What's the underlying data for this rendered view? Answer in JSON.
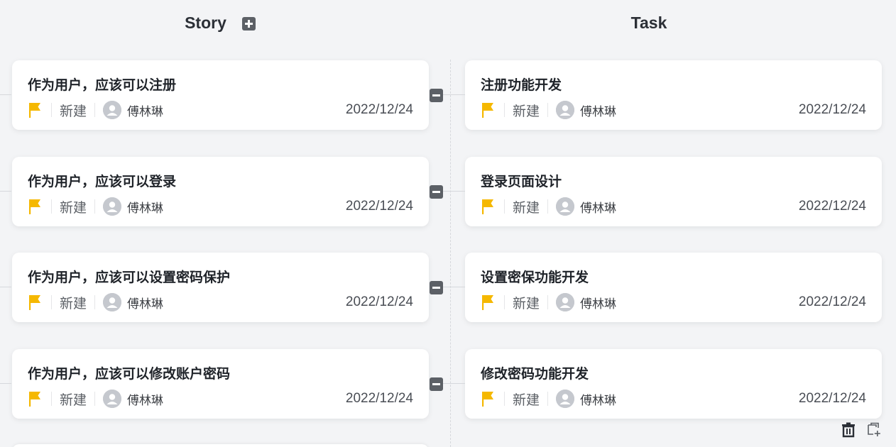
{
  "columns": {
    "story": {
      "title": "Story"
    },
    "task": {
      "title": "Task"
    }
  },
  "rows": [
    {
      "story": {
        "title": "作为用户，应该可以注册",
        "status": "新建",
        "assignee": "傅林琳",
        "date": "2022/12/24"
      },
      "task": {
        "title": "注册功能开发",
        "status": "新建",
        "assignee": "傅林琳",
        "date": "2022/12/24"
      }
    },
    {
      "story": {
        "title": "作为用户，应该可以登录",
        "status": "新建",
        "assignee": "傅林琳",
        "date": "2022/12/24"
      },
      "task": {
        "title": "登录页面设计",
        "status": "新建",
        "assignee": "傅林琳",
        "date": "2022/12/24"
      }
    },
    {
      "story": {
        "title": "作为用户，应该可以设置密码保护",
        "status": "新建",
        "assignee": "傅林琳",
        "date": "2022/12/24"
      },
      "task": {
        "title": "设置密保功能开发",
        "status": "新建",
        "assignee": "傅林琳",
        "date": "2022/12/24"
      }
    },
    {
      "story": {
        "title": "作为用户，应该可以修改账户密码",
        "status": "新建",
        "assignee": "傅林琳",
        "date": "2022/12/24"
      },
      "task": {
        "title": "修改密码功能开发",
        "status": "新建",
        "assignee": "傅林琳",
        "date": "2022/12/24"
      }
    }
  ],
  "icons": {
    "flag": "flag-icon",
    "avatar": "user-avatar-icon",
    "add": "plus-icon",
    "collapse": "minus-icon",
    "delete": "trash-icon",
    "add_link": "add-card-icon"
  },
  "colors": {
    "flag": "#f5b800",
    "background": "#f3f4f6",
    "card": "#ffffff",
    "button": "#5c6066"
  }
}
